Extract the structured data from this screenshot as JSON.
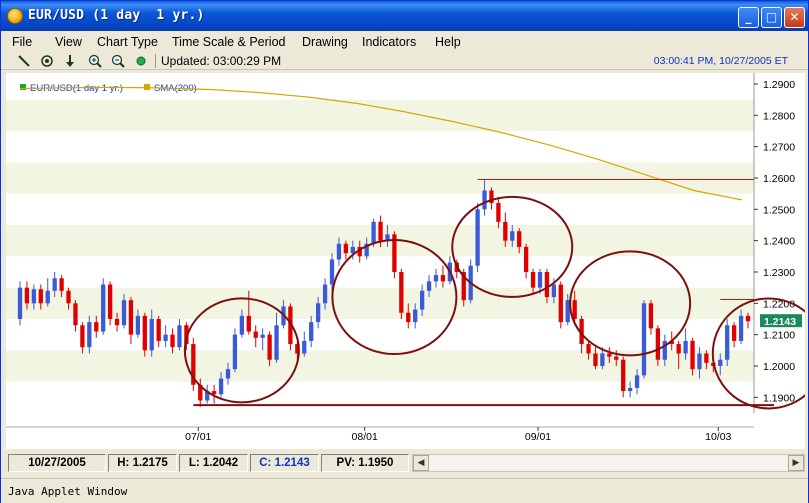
{
  "window": {
    "title": "EUR/USD (1 day  1 yr.)",
    "controls": {
      "minimize": "_",
      "maximize": "□",
      "close": "✕"
    }
  },
  "menu": [
    "File",
    "View",
    "Chart Type",
    "Time Scale & Period",
    "Drawing",
    "Indicators",
    "Help"
  ],
  "toolbar": {
    "tools": [
      "line-tool-icon",
      "crosshair-icon",
      "arrow-down-icon",
      "zoom-in-icon",
      "zoom-out-icon",
      "status-dot-icon"
    ],
    "updated_text": "Updated: 03:00:29 PM",
    "clock_text": "03:00:41 PM, 10/27/2005 ET"
  },
  "legend": {
    "series_label": "EUR/USD(1 day  1 yr.)",
    "series_color": "#21a821",
    "sma_label": "SMA(200)",
    "sma_color": "#d4a800"
  },
  "axis": {
    "y_ticks": [
      "1.2900",
      "1.2800",
      "1.2700",
      "1.2600",
      "1.2500",
      "1.2400",
      "1.2300",
      "1.2200",
      "1.2100",
      "1.2000",
      "1.1900"
    ],
    "x_ticks": [
      "07/01",
      "08/01",
      "09/01",
      "10/03"
    ],
    "current_price": "1.2143",
    "current_price_color": "#1a8a5a"
  },
  "colors": {
    "up": "#3a5ad8",
    "down": "#e00000",
    "band": "#f3f5e3",
    "circle": "#7a1010",
    "hline": "#d01010",
    "baseline": "#7a1010"
  },
  "chart_data": {
    "type": "candlestick",
    "ylim": [
      1.185,
      1.2935
    ],
    "sma200": [
      1.2885,
      1.2888,
      1.2889,
      1.2887,
      1.2882,
      1.2872,
      1.2858,
      1.2838,
      1.2811,
      1.278,
      1.2745,
      1.2705,
      1.266,
      1.261,
      1.256,
      1.253
    ],
    "resistance_levels": [
      1.2595,
      1.2212
    ],
    "support_level": 1.1875,
    "candles": [
      [
        1.215,
        1.225,
        1.227,
        1.213
      ],
      [
        1.225,
        1.22,
        1.227,
        1.218
      ],
      [
        1.22,
        1.2245,
        1.226,
        1.218
      ],
      [
        1.2245,
        1.22,
        1.226,
        1.218
      ],
      [
        1.22,
        1.224,
        1.228,
        1.219
      ],
      [
        1.224,
        1.228,
        1.23,
        1.222
      ],
      [
        1.228,
        1.224,
        1.229,
        1.222
      ],
      [
        1.224,
        1.22,
        1.225,
        1.218
      ],
      [
        1.22,
        1.213,
        1.221,
        1.211
      ],
      [
        1.213,
        1.206,
        1.214,
        1.204
      ],
      [
        1.206,
        1.214,
        1.216,
        1.204
      ],
      [
        1.214,
        1.211,
        1.216,
        1.209
      ],
      [
        1.211,
        1.226,
        1.228,
        1.21
      ],
      [
        1.226,
        1.215,
        1.227,
        1.213
      ],
      [
        1.215,
        1.213,
        1.217,
        1.211
      ],
      [
        1.213,
        1.221,
        1.223,
        1.212
      ],
      [
        1.221,
        1.21,
        1.222,
        1.207
      ],
      [
        1.21,
        1.216,
        1.218,
        1.209
      ],
      [
        1.216,
        1.205,
        1.217,
        1.203
      ],
      [
        1.205,
        1.215,
        1.218,
        1.203
      ],
      [
        1.215,
        1.208,
        1.216,
        1.206
      ],
      [
        1.208,
        1.21,
        1.213,
        1.206
      ],
      [
        1.21,
        1.206,
        1.212,
        1.204
      ],
      [
        1.206,
        1.213,
        1.215,
        1.205
      ],
      [
        1.213,
        1.207,
        1.214,
        1.205
      ],
      [
        1.207,
        1.194,
        1.209,
        1.192
      ],
      [
        1.194,
        1.189,
        1.196,
        1.187
      ],
      [
        1.189,
        1.192,
        1.194,
        1.188
      ],
      [
        1.192,
        1.191,
        1.194,
        1.188
      ],
      [
        1.191,
        1.196,
        1.198,
        1.19
      ],
      [
        1.196,
        1.199,
        1.201,
        1.194
      ],
      [
        1.199,
        1.21,
        1.212,
        1.198
      ],
      [
        1.21,
        1.216,
        1.218,
        1.209
      ],
      [
        1.216,
        1.211,
        1.224,
        1.21
      ],
      [
        1.211,
        1.209,
        1.213,
        1.206
      ],
      [
        1.209,
        1.21,
        1.212,
        1.205
      ],
      [
        1.21,
        1.202,
        1.211,
        1.2
      ],
      [
        1.202,
        1.213,
        1.217,
        1.201
      ],
      [
        1.213,
        1.219,
        1.221,
        1.212
      ],
      [
        1.219,
        1.207,
        1.22,
        1.205
      ],
      [
        1.207,
        1.204,
        1.208,
        1.202
      ],
      [
        1.204,
        1.208,
        1.211,
        1.203
      ],
      [
        1.208,
        1.214,
        1.216,
        1.206
      ],
      [
        1.214,
        1.22,
        1.222,
        1.212
      ],
      [
        1.22,
        1.226,
        1.228,
        1.218
      ],
      [
        1.226,
        1.234,
        1.236,
        1.224
      ],
      [
        1.234,
        1.239,
        1.241,
        1.232
      ],
      [
        1.239,
        1.236,
        1.24,
        1.234
      ],
      [
        1.236,
        1.238,
        1.24,
        1.234
      ],
      [
        1.238,
        1.235,
        1.24,
        1.233
      ],
      [
        1.235,
        1.239,
        1.241,
        1.234
      ],
      [
        1.239,
        1.246,
        1.247,
        1.238
      ],
      [
        1.246,
        1.24,
        1.248,
        1.238
      ],
      [
        1.24,
        1.242,
        1.245,
        1.238
      ],
      [
        1.242,
        1.23,
        1.243,
        1.228
      ],
      [
        1.23,
        1.217,
        1.231,
        1.215
      ],
      [
        1.217,
        1.214,
        1.22,
        1.212
      ],
      [
        1.214,
        1.218,
        1.22,
        1.212
      ],
      [
        1.218,
        1.224,
        1.226,
        1.216
      ],
      [
        1.224,
        1.227,
        1.229,
        1.222
      ],
      [
        1.227,
        1.229,
        1.231,
        1.225
      ],
      [
        1.229,
        1.227,
        1.232,
        1.225
      ],
      [
        1.227,
        1.233,
        1.235,
        1.226
      ],
      [
        1.233,
        1.23,
        1.234,
        1.228
      ],
      [
        1.23,
        1.221,
        1.231,
        1.219
      ],
      [
        1.221,
        1.232,
        1.234,
        1.22
      ],
      [
        1.232,
        1.25,
        1.252,
        1.23
      ],
      [
        1.25,
        1.256,
        1.2595,
        1.248
      ],
      [
        1.256,
        1.252,
        1.257,
        1.25
      ],
      [
        1.252,
        1.246,
        1.254,
        1.244
      ],
      [
        1.246,
        1.24,
        1.249,
        1.238
      ],
      [
        1.24,
        1.243,
        1.245,
        1.238
      ],
      [
        1.243,
        1.238,
        1.244,
        1.236
      ],
      [
        1.238,
        1.23,
        1.239,
        1.228
      ],
      [
        1.23,
        1.225,
        1.231,
        1.223
      ],
      [
        1.225,
        1.23,
        1.231,
        1.223
      ],
      [
        1.23,
        1.222,
        1.231,
        1.22
      ],
      [
        1.222,
        1.226,
        1.228,
        1.22
      ],
      [
        1.226,
        1.214,
        1.227,
        1.212
      ],
      [
        1.214,
        1.221,
        1.223,
        1.213
      ],
      [
        1.221,
        1.215,
        1.224,
        1.213
      ],
      [
        1.215,
        1.207,
        1.216,
        1.204
      ],
      [
        1.207,
        1.204,
        1.208,
        1.202
      ],
      [
        1.204,
        1.2,
        1.206,
        1.199
      ],
      [
        1.2,
        1.204,
        1.206,
        1.199
      ],
      [
        1.204,
        1.203,
        1.206,
        1.201
      ],
      [
        1.203,
        1.202,
        1.205,
        1.2
      ],
      [
        1.202,
        1.192,
        1.203,
        1.19
      ],
      [
        1.192,
        1.193,
        1.195,
        1.19
      ],
      [
        1.193,
        1.197,
        1.199,
        1.191
      ],
      [
        1.197,
        1.22,
        1.221,
        1.196
      ],
      [
        1.22,
        1.212,
        1.221,
        1.21
      ],
      [
        1.212,
        1.202,
        1.213,
        1.2
      ],
      [
        1.202,
        1.208,
        1.21,
        1.2
      ],
      [
        1.208,
        1.207,
        1.211,
        1.205
      ],
      [
        1.207,
        1.204,
        1.208,
        1.199
      ],
      [
        1.204,
        1.208,
        1.212,
        1.202
      ],
      [
        1.208,
        1.199,
        1.209,
        1.197
      ],
      [
        1.199,
        1.204,
        1.206,
        1.196
      ],
      [
        1.204,
        1.201,
        1.205,
        1.199
      ],
      [
        1.201,
        1.2,
        1.203,
        1.198
      ],
      [
        1.2,
        1.202,
        1.204,
        1.197
      ],
      [
        1.202,
        1.213,
        1.215,
        1.2
      ],
      [
        1.213,
        1.208,
        1.214,
        1.206
      ],
      [
        1.208,
        1.216,
        1.218,
        1.207
      ],
      [
        1.216,
        1.2143,
        1.217,
        1.212
      ]
    ]
  },
  "status": {
    "date": "10/27/2005",
    "high": "H: 1.2175",
    "low": "L: 1.2042",
    "close": "C: 1.2143",
    "pv": "PV: 1.1950"
  },
  "footer": "Java Applet Window"
}
